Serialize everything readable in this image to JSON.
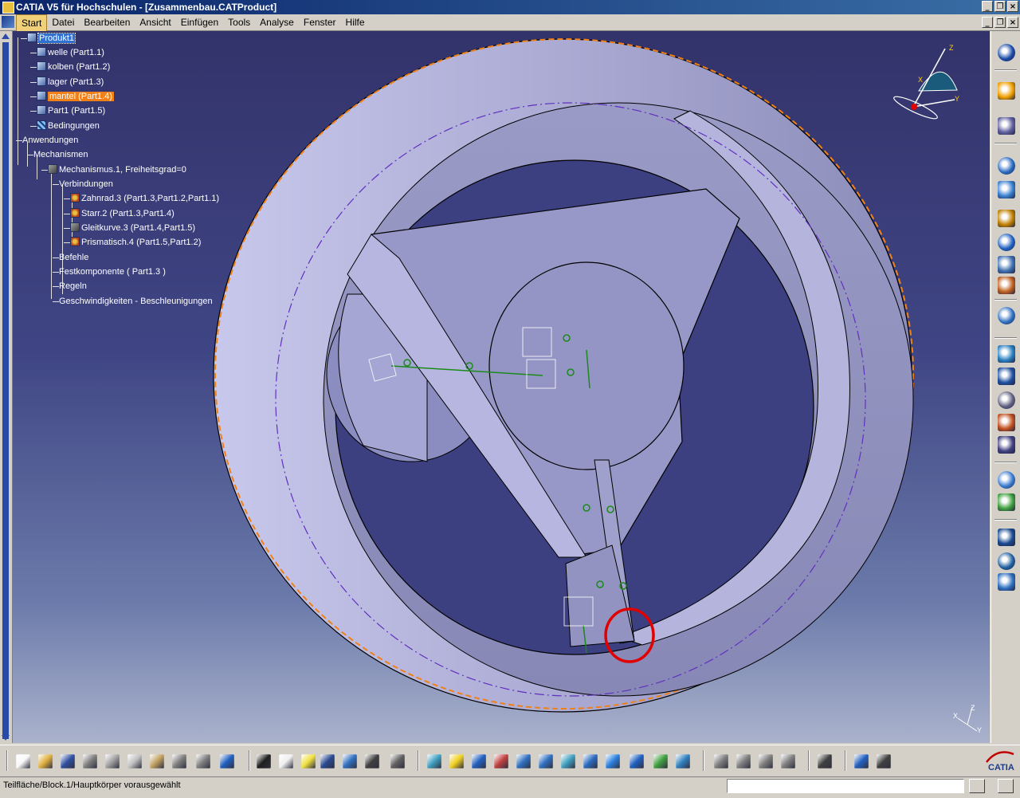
{
  "window": {
    "title": "CATIA V5 für Hochschulen - [Zusammenbau.CATProduct]"
  },
  "menubar": {
    "items": [
      "Start",
      "Datei",
      "Bearbeiten",
      "Ansicht",
      "Einfügen",
      "Tools",
      "Analyse",
      "Fenster",
      "Hilfe"
    ],
    "active": "Start"
  },
  "tree": {
    "nodes": [
      {
        "label": "Produkt1",
        "icon": "product-icon",
        "state": "selected"
      },
      {
        "label": "welle (Part1.1)",
        "icon": "part-icon"
      },
      {
        "label": "kolben (Part1.2)",
        "icon": "part-icon"
      },
      {
        "label": "lager (Part1.3)",
        "icon": "part-icon"
      },
      {
        "label": "mantel (Part1.4)",
        "icon": "part-icon",
        "state": "highlighted"
      },
      {
        "label": "Part1 (Part1.5)",
        "icon": "part-icon"
      },
      {
        "label": "Bedingungen",
        "icon": "constraints-icon"
      },
      {
        "label": "Anwendungen",
        "icon": "none"
      },
      {
        "label": "Mechanismen",
        "icon": "none"
      },
      {
        "label": "Mechanismus.1, Freiheitsgrad=0",
        "icon": "mechanism-icon"
      },
      {
        "label": "Verbindungen",
        "icon": "none"
      },
      {
        "label": "Zahnrad.3 (Part1.3,Part1.2,Part1.1)",
        "icon": "gear-joint-icon"
      },
      {
        "label": "Starr.2 (Part1.3,Part1.4)",
        "icon": "rigid-joint-icon"
      },
      {
        "label": "Gleitkurve.3 (Part1.4,Part1.5)",
        "icon": "slide-curve-icon"
      },
      {
        "label": "Prismatisch.4 (Part1.5,Part1.2)",
        "icon": "prismatic-joint-icon"
      },
      {
        "label": "Befehle",
        "icon": "none"
      },
      {
        "label": "Festkomponente ( Part1.3 )",
        "icon": "none"
      },
      {
        "label": "Regeln",
        "icon": "none"
      },
      {
        "label": "Geschwindigkeiten - Beschleunigungen",
        "icon": "none"
      }
    ]
  },
  "compass": {
    "axes": [
      "X",
      "Y",
      "Z"
    ]
  },
  "triad": {
    "axes": [
      "X",
      "Y",
      "Z"
    ]
  },
  "statusbar": {
    "message": "Teilfläche/Block.1/Hauptkörper vorausgewählt",
    "command_input": ""
  },
  "right_toolbar": {
    "icons": [
      "compass-icon",
      "select-arrow-icon",
      "manipulate-icon",
      "sweep-icon",
      "snap-icon",
      "new-product-icon",
      "anchor-icon",
      "fix-icon",
      "explode-icon",
      "clash-icon",
      "measure-icon",
      "grid-icon",
      "bom-icon",
      "build-icon",
      "joint-icon",
      "simulate-icon",
      "analyze-icon",
      "dmu-icon",
      "rotation-icon",
      "kinematic-icon"
    ]
  },
  "bottom_toolbar": {
    "icons": [
      "new-icon",
      "open-icon",
      "save-icon",
      "print-icon",
      "cut-icon",
      "copy-icon",
      "paste-icon",
      "undo-icon",
      "redo-icon",
      "whats-this-icon",
      "formula-icon",
      "comment-icon",
      "light-bulb-icon",
      "table-icon",
      "tree-graph-icon",
      "catalog-icon",
      "filter-icon",
      "fly-mode-icon",
      "fit-all-icon",
      "pan-icon",
      "rotate-icon",
      "zoom-in-icon",
      "zoom-out-icon",
      "normal-view-icon",
      "multi-view-icon",
      "iso-view-icon",
      "hide-show-icon",
      "swap-visible-icon",
      "render-style-icon",
      "selection-sets-icon",
      "next-icon",
      "spec-icon",
      "other-icon",
      "camera-icon",
      "measure-between-icon",
      "dimension-icon"
    ]
  },
  "colors": {
    "viewport_top": "#33336b",
    "viewport_bottom": "#aab2cc",
    "part_face": "#8f8fbd",
    "highlight_orange": "#f08018",
    "selection_blue": "#3070d0",
    "annotation_red": "#e00000"
  }
}
